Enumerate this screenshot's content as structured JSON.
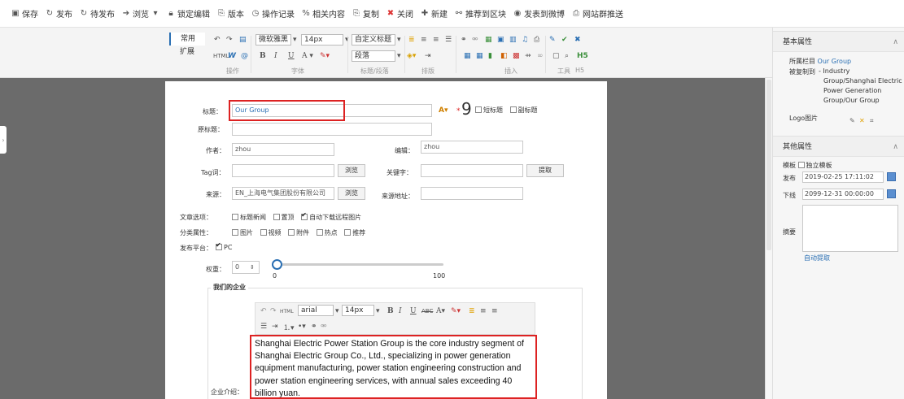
{
  "toolbar": {
    "save": "保存",
    "publish": "发布",
    "pending": "待发布",
    "browse": "浏览",
    "lock_edit": "锁定编辑",
    "version": "版本",
    "op_log": "操作记录",
    "related": "相关内容",
    "copy": "复制",
    "close": "关闭",
    "new": "新建",
    "push_block": "推荐到区块",
    "weibo": "发表到微博",
    "group_push": "网站群推送"
  },
  "ribbon": {
    "tab_common": "常用",
    "tab_expand": "扩展",
    "font_family": "微软雅黑",
    "font_size": "14px",
    "heading_select": "自定义标题",
    "paragraph": "段落",
    "group_ops": "操作",
    "group_font": "字体",
    "group_heading": "标题/段落",
    "group_layout": "排版",
    "group_insert": "插入",
    "group_tools": "工具",
    "group_h5": "H5"
  },
  "form": {
    "title_label": "标题：",
    "title_value": "Our Group",
    "title_count": "9",
    "short_title": "短标题",
    "sub_title": "副标题",
    "orig_title_label": "原标题：",
    "author_label": "作者：",
    "author_value": "zhou",
    "editor_label": "编辑：",
    "editor_value": "zhou",
    "tag_label": "Tag词：",
    "browse_btn": "浏览",
    "keyword_label": "关键字：",
    "extract_btn": "提取",
    "source_label": "来源：",
    "source_value": "EN_上海电气集团股份有限公司",
    "source_browse": "浏览",
    "source_url_label": "来源地址：",
    "options_label": "文章选项：",
    "opt_headline": "标题新闻",
    "opt_top": "置顶",
    "opt_download": "自动下载远程图片",
    "category_label": "分类属性：",
    "cat_image": "图片",
    "cat_video": "视频",
    "cat_attach": "附件",
    "cat_hot": "热点",
    "cat_recommend": "推荐",
    "platform_label": "发布平台：",
    "platform_pc": "PC",
    "weight_label": "权重：",
    "weight_value": "0",
    "slider_min": "0",
    "slider_max": "100",
    "section_legend": "我们的企业",
    "intro_label": "企业介绍：",
    "intro_text": "Shanghai Electric Power Station Group is the core industry segment of Shanghai Electric Group Co., Ltd., specializing in power generation equipment manufacturing, power station engineering construction and power station engineering services, with annual sales exceeding 40 billion yuan.",
    "inner_font": "arial",
    "inner_size": "14px"
  },
  "right_panel": {
    "basic_title": "基本属性",
    "column_label": "所属栏目",
    "column_value": "Our Group",
    "copied_label": "被复制到",
    "copied_value_lines": [
      "- Industry",
      "Group/Shanghai Electric",
      "Power Generation",
      "Group/Our Group"
    ],
    "logo_label": "Logo图片",
    "other_title": "其他属性",
    "template_label": "模板",
    "template_opt": "独立模板",
    "publish_label": "发布",
    "publish_value": "2019-02-25 17:11:02",
    "offline_label": "下线",
    "offline_value": "2099-12-31 00:00:00",
    "summary_label": "摘要",
    "auto_extract": "自动提取"
  },
  "colors": {
    "highlight": "#d22222",
    "link": "#2a6fb3",
    "work_bg": "#6b6b6b"
  }
}
